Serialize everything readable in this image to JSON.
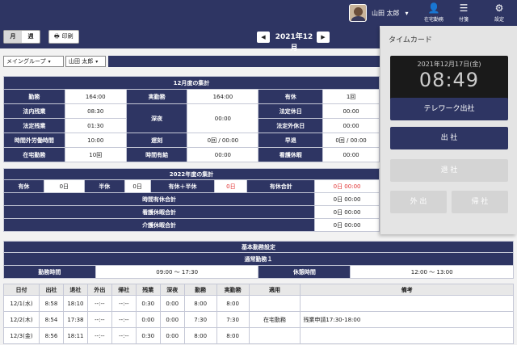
{
  "header": {
    "user_name": "山田 太郎",
    "remote_label": "在宅勤務",
    "memo_label": "付箋",
    "settings_label": "設定"
  },
  "toolbar": {
    "view_month": "月",
    "view_week": "週",
    "print_label": "印刷",
    "month_label": "2021年12月"
  },
  "filters": {
    "group": "メイングループ",
    "user": "山田 太郎"
  },
  "monthly_summary": {
    "title": "12月度の集計",
    "rows": [
      {
        "l1": "勤務",
        "v1": "164:00",
        "l2": "実勤務",
        "v2": "164:00",
        "l3": "有休",
        "v3": "1回"
      },
      {
        "l1": "法内残業",
        "v1": "08:30",
        "l2": "深夜",
        "v2": "00:00",
        "l3": "法定休日",
        "v3": "00:00"
      },
      {
        "l1": "法定残業",
        "v1": "01:30",
        "l3": "法定外休日",
        "v3": "00:00"
      },
      {
        "l1": "時間外労働時間",
        "v1": "10:00",
        "l2": "遅刻",
        "v2": "0回 / 00:00",
        "l3": "早退",
        "v3": "0回 / 00:00"
      },
      {
        "l1": "在宅勤務",
        "v1": "10回",
        "l2": "時間有給",
        "v2": "00:00",
        "l3": "看護休暇",
        "v3": "00:00"
      }
    ]
  },
  "annual_summary": {
    "title": "2022年度の集計",
    "paid_leave_label": "有休",
    "paid_leave_value": "0日",
    "half_label": "半休",
    "half_value": "0日",
    "combined_label": "有休＋半休",
    "combined_value": "0日",
    "total_label": "有休合計",
    "total_value": "0日 00:00",
    "rows": [
      {
        "label": "時間有休合計",
        "value": "0日 00:00"
      },
      {
        "label": "看護休暇合計",
        "value": "0日 00:00"
      },
      {
        "label": "介護休暇合計",
        "value": "0日 00:00"
      }
    ]
  },
  "basic_settings": {
    "title": "基本勤務設定",
    "pattern": "通常勤務１",
    "work_time_label": "勤務時間",
    "work_time_value": "09:00 ～ 17:30",
    "break_label": "休憩時間",
    "break_value": "12:00 ～ 13:00"
  },
  "daily_table": {
    "columns": [
      "日付",
      "出社",
      "退社",
      "外出",
      "帰社",
      "残業",
      "深夜",
      "勤務",
      "実勤務",
      "適用",
      "備考"
    ],
    "rows": [
      [
        "12/1(水)",
        "8:58",
        "18:10",
        "--:--",
        "--:--",
        "0:30",
        "0:00",
        "8:00",
        "8:00",
        "",
        ""
      ],
      [
        "12/2(木)",
        "8:54",
        "17:38",
        "--:--",
        "--:--",
        "0:00",
        "0:00",
        "7:30",
        "7:30",
        "在宅勤務",
        "残業申請17:30-18:00"
      ],
      [
        "12/3(金)",
        "8:56",
        "18:11",
        "--:--",
        "--:--",
        "0:30",
        "0:00",
        "8:00",
        "8:00",
        "",
        ""
      ]
    ]
  },
  "timecard": {
    "title": "タイムカード",
    "date": "2021年12月17日(金)",
    "time": "08:49",
    "telework_label": "テレワーク出社",
    "clock_in_label": "出 社",
    "clock_out_label": "退 社",
    "go_out_label": "外 出",
    "return_label": "帰 社"
  }
}
